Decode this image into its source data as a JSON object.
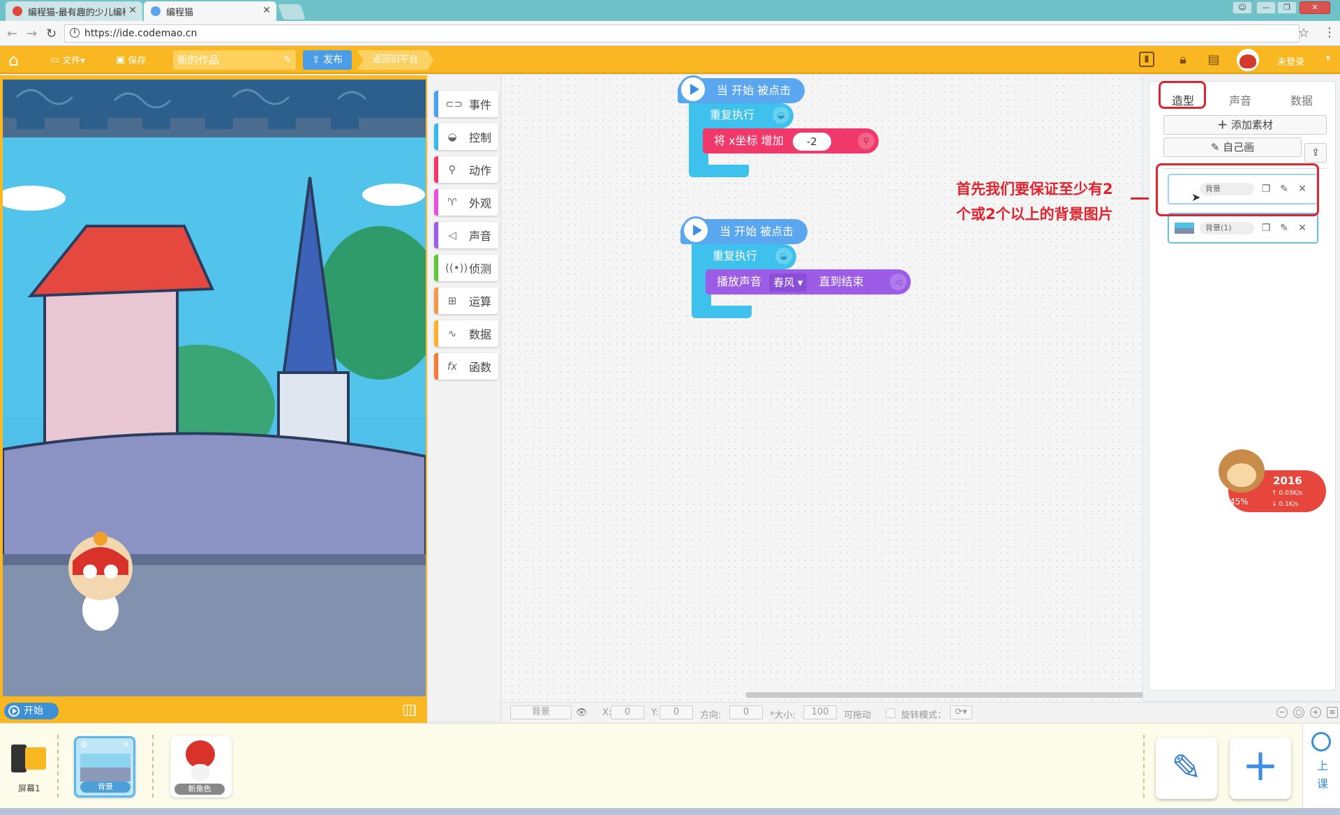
{
  "browser": {
    "tabs": [
      {
        "label": "编程猫-最有趣的少儿编程"
      },
      {
        "label": "编程猫"
      }
    ],
    "url": "https://ide.codemao.cn"
  },
  "toolbar": {
    "file_label": "文件▾",
    "save_label": "保存",
    "project_title": "新的作品",
    "publish_label": "发布",
    "back_old_label": "返回旧平台",
    "login_label": "未登录"
  },
  "stage": {
    "start_label": "开始"
  },
  "palette": {
    "categories": [
      {
        "label": "事件",
        "color": "#4d9ff0",
        "icon": "toggle-icon"
      },
      {
        "label": "控制",
        "color": "#35b9e8",
        "icon": "gamepad-icon"
      },
      {
        "label": "动作",
        "color": "#f0386a",
        "icon": "run-icon"
      },
      {
        "label": "外观",
        "color": "#e450d8",
        "icon": "shirt-icon"
      },
      {
        "label": "声音",
        "color": "#9c5ce6",
        "icon": "speaker-icon"
      },
      {
        "label": "侦测",
        "color": "#60c53d",
        "icon": "radar-icon"
      },
      {
        "label": "运算",
        "color": "#f29a4a",
        "icon": "calc-icon"
      },
      {
        "label": "数据",
        "color": "#f6b22c",
        "icon": "chart-icon"
      },
      {
        "label": "函数",
        "color": "#f47a3a",
        "icon": "fx-icon"
      }
    ]
  },
  "scripts": [
    {
      "hat": "当 开始 被点击",
      "loop": "重复执行",
      "action_label": "将 x坐标 增加",
      "action_value": "-2"
    },
    {
      "hat": "当 开始 被点击",
      "loop": "重复执行",
      "action_label": "播放声音",
      "action_dropdown": "春风",
      "action_suffix": "直到结束"
    }
  ],
  "properties": {
    "name": "背景",
    "x_label": "X:",
    "x": "0",
    "y_label": "Y:",
    "y": "0",
    "direction_label": "方向:",
    "direction": "0",
    "size_label": "*大小:",
    "size": "100",
    "draggable_label": "可拖动",
    "rotation_label": "旋转模式："
  },
  "assets_panel": {
    "tabs": [
      "造型",
      "声音",
      "数据"
    ],
    "add_material": "添加素材",
    "draw_self": "自己画",
    "items": [
      {
        "name": "背景"
      },
      {
        "name": "背景(1)"
      }
    ]
  },
  "annotation": {
    "line1": "首先我们要保证至少有2",
    "line2": "个或2个以上的背景图片"
  },
  "mascot": {
    "year": "2016",
    "percent": "45%",
    "up_speed": "0.03K/s",
    "down_speed": "0.1K/s"
  },
  "sprites": {
    "screen_label": "屏幕1",
    "items": [
      {
        "label": "背景"
      },
      {
        "label": "新角色"
      }
    ],
    "lesson_label": "上课"
  }
}
